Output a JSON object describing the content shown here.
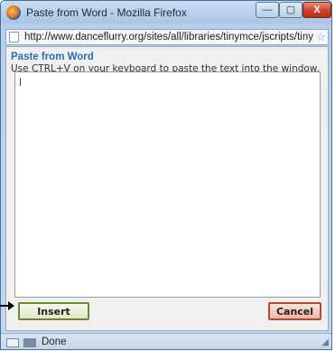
{
  "window": {
    "title": "Paste from Word - Mozilla Firefox",
    "controls": {
      "minimize": "—",
      "maximize": "▢",
      "close": "X"
    }
  },
  "urlbar": {
    "url": "http://www.danceflurry.org/sites/all/libraries/tinymce/jscripts/tiny_mce/p",
    "star": "☆"
  },
  "dialog": {
    "title": "Paste from Word",
    "instruction": "Use CTRL+V on your keyboard to paste the text into the window.",
    "insert_label": "Insert",
    "cancel_label": "Cancel"
  },
  "statusbar": {
    "status": "Done"
  },
  "colors": {
    "accent": "#2b6fb6",
    "insert_border": "#6a8a3a",
    "cancel_border": "#b54a3a"
  }
}
